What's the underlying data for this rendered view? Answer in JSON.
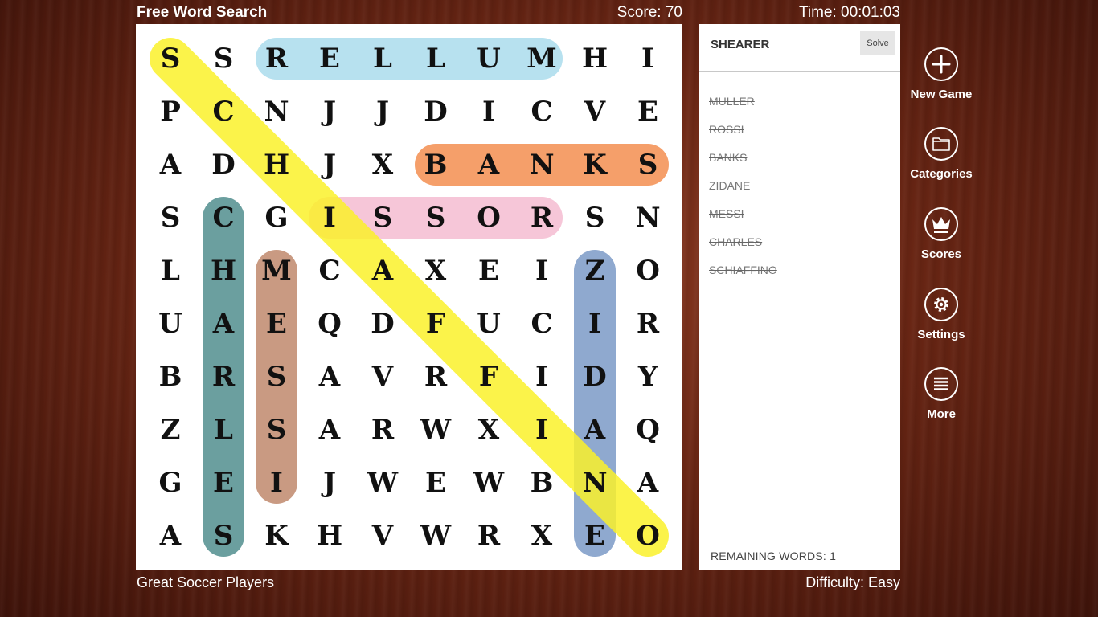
{
  "app": {
    "title": "Free Word Search"
  },
  "status": {
    "score": "Score: 70",
    "time": "Time: 00:01:03"
  },
  "footer": {
    "category": "Great Soccer Players",
    "difficulty": "Difficulty: Easy"
  },
  "grid": [
    [
      "S",
      "S",
      "R",
      "E",
      "L",
      "L",
      "U",
      "M",
      "H",
      "I"
    ],
    [
      "P",
      "C",
      "N",
      "J",
      "J",
      "D",
      "I",
      "C",
      "V",
      "E"
    ],
    [
      "A",
      "D",
      "H",
      "J",
      "X",
      "B",
      "A",
      "N",
      "K",
      "S"
    ],
    [
      "S",
      "C",
      "G",
      "I",
      "S",
      "S",
      "O",
      "R",
      "S",
      "N"
    ],
    [
      "L",
      "H",
      "M",
      "C",
      "A",
      "X",
      "E",
      "I",
      "Z",
      "O"
    ],
    [
      "U",
      "A",
      "E",
      "Q",
      "D",
      "F",
      "U",
      "C",
      "I",
      "R"
    ],
    [
      "B",
      "R",
      "S",
      "A",
      "V",
      "R",
      "F",
      "I",
      "D",
      "Y"
    ],
    [
      "Z",
      "L",
      "S",
      "A",
      "R",
      "W",
      "X",
      "I",
      "A",
      "Q"
    ],
    [
      "G",
      "E",
      "I",
      "J",
      "W",
      "E",
      "W",
      "B",
      "N",
      "A"
    ],
    [
      "A",
      "S",
      "K",
      "H",
      "V",
      "W",
      "R",
      "X",
      "E",
      "O"
    ]
  ],
  "found": [
    {
      "word": "MULLER",
      "from": [
        0,
        7
      ],
      "to": [
        0,
        2
      ],
      "color": "#b7e1ef"
    },
    {
      "word": "BANKS",
      "from": [
        2,
        5
      ],
      "to": [
        2,
        9
      ],
      "color": "#f59f6a"
    },
    {
      "word": "ROSSI",
      "from": [
        3,
        7
      ],
      "to": [
        3,
        3
      ],
      "color": "#f6c6d8"
    },
    {
      "word": "CHARLES",
      "from": [
        3,
        1
      ],
      "to": [
        9,
        1
      ],
      "color": "#6b9f9f"
    },
    {
      "word": "MESSI",
      "from": [
        4,
        2
      ],
      "to": [
        8,
        2
      ],
      "color": "#c99a82"
    },
    {
      "word": "ZIDANE",
      "from": [
        4,
        8
      ],
      "to": [
        9,
        8
      ],
      "color": "#8fa9cf"
    },
    {
      "word": "SCHIAFFINO",
      "from": [
        0,
        0
      ],
      "to": [
        9,
        9
      ],
      "color": "#fbf12b"
    }
  ],
  "panel": {
    "current_word": "SHEARER",
    "solve_label": "Solve",
    "words": [
      "MULLER",
      "ROSSI",
      "BANKS",
      "ZIDANE",
      "MESSI",
      "CHARLES",
      "SCHIAFFINO"
    ],
    "remaining": "REMAINING WORDS: 1"
  },
  "sidebar": {
    "new_game": "New Game",
    "categories": "Categories",
    "scores": "Scores",
    "settings": "Settings",
    "more": "More"
  }
}
